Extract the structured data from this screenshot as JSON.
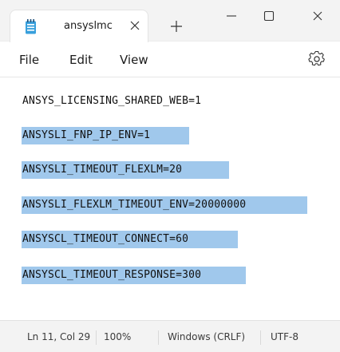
{
  "window": {
    "tab_title": "ansyslmc",
    "controls": {
      "minimize": "minimize-icon",
      "maximize": "maximize-icon",
      "close": "close-icon"
    }
  },
  "menu": {
    "file": "File",
    "edit": "Edit",
    "view": "View"
  },
  "editor": {
    "lines": [
      "ANSYS_LICENSING_SHARED_WEB=1",
      "ANSYSLI_FNP_IP_ENV=1",
      "ANSYSLI_TIMEOUT_FLEXLM=20",
      "ANSYSLI_FLEXLM_TIMEOUT_ENV=20000000",
      "ANSYSCL_TIMEOUT_CONNECT=60",
      "ANSYSCL_TIMEOUT_RESPONSE=300"
    ],
    "selected_lines": [
      2,
      3,
      4,
      5,
      6
    ],
    "selection_color": "#a0c8ec"
  },
  "status": {
    "position": "Ln 11, Col 29",
    "zoom": "100%",
    "line_ending": "Windows (CRLF)",
    "encoding": "UTF-8"
  }
}
